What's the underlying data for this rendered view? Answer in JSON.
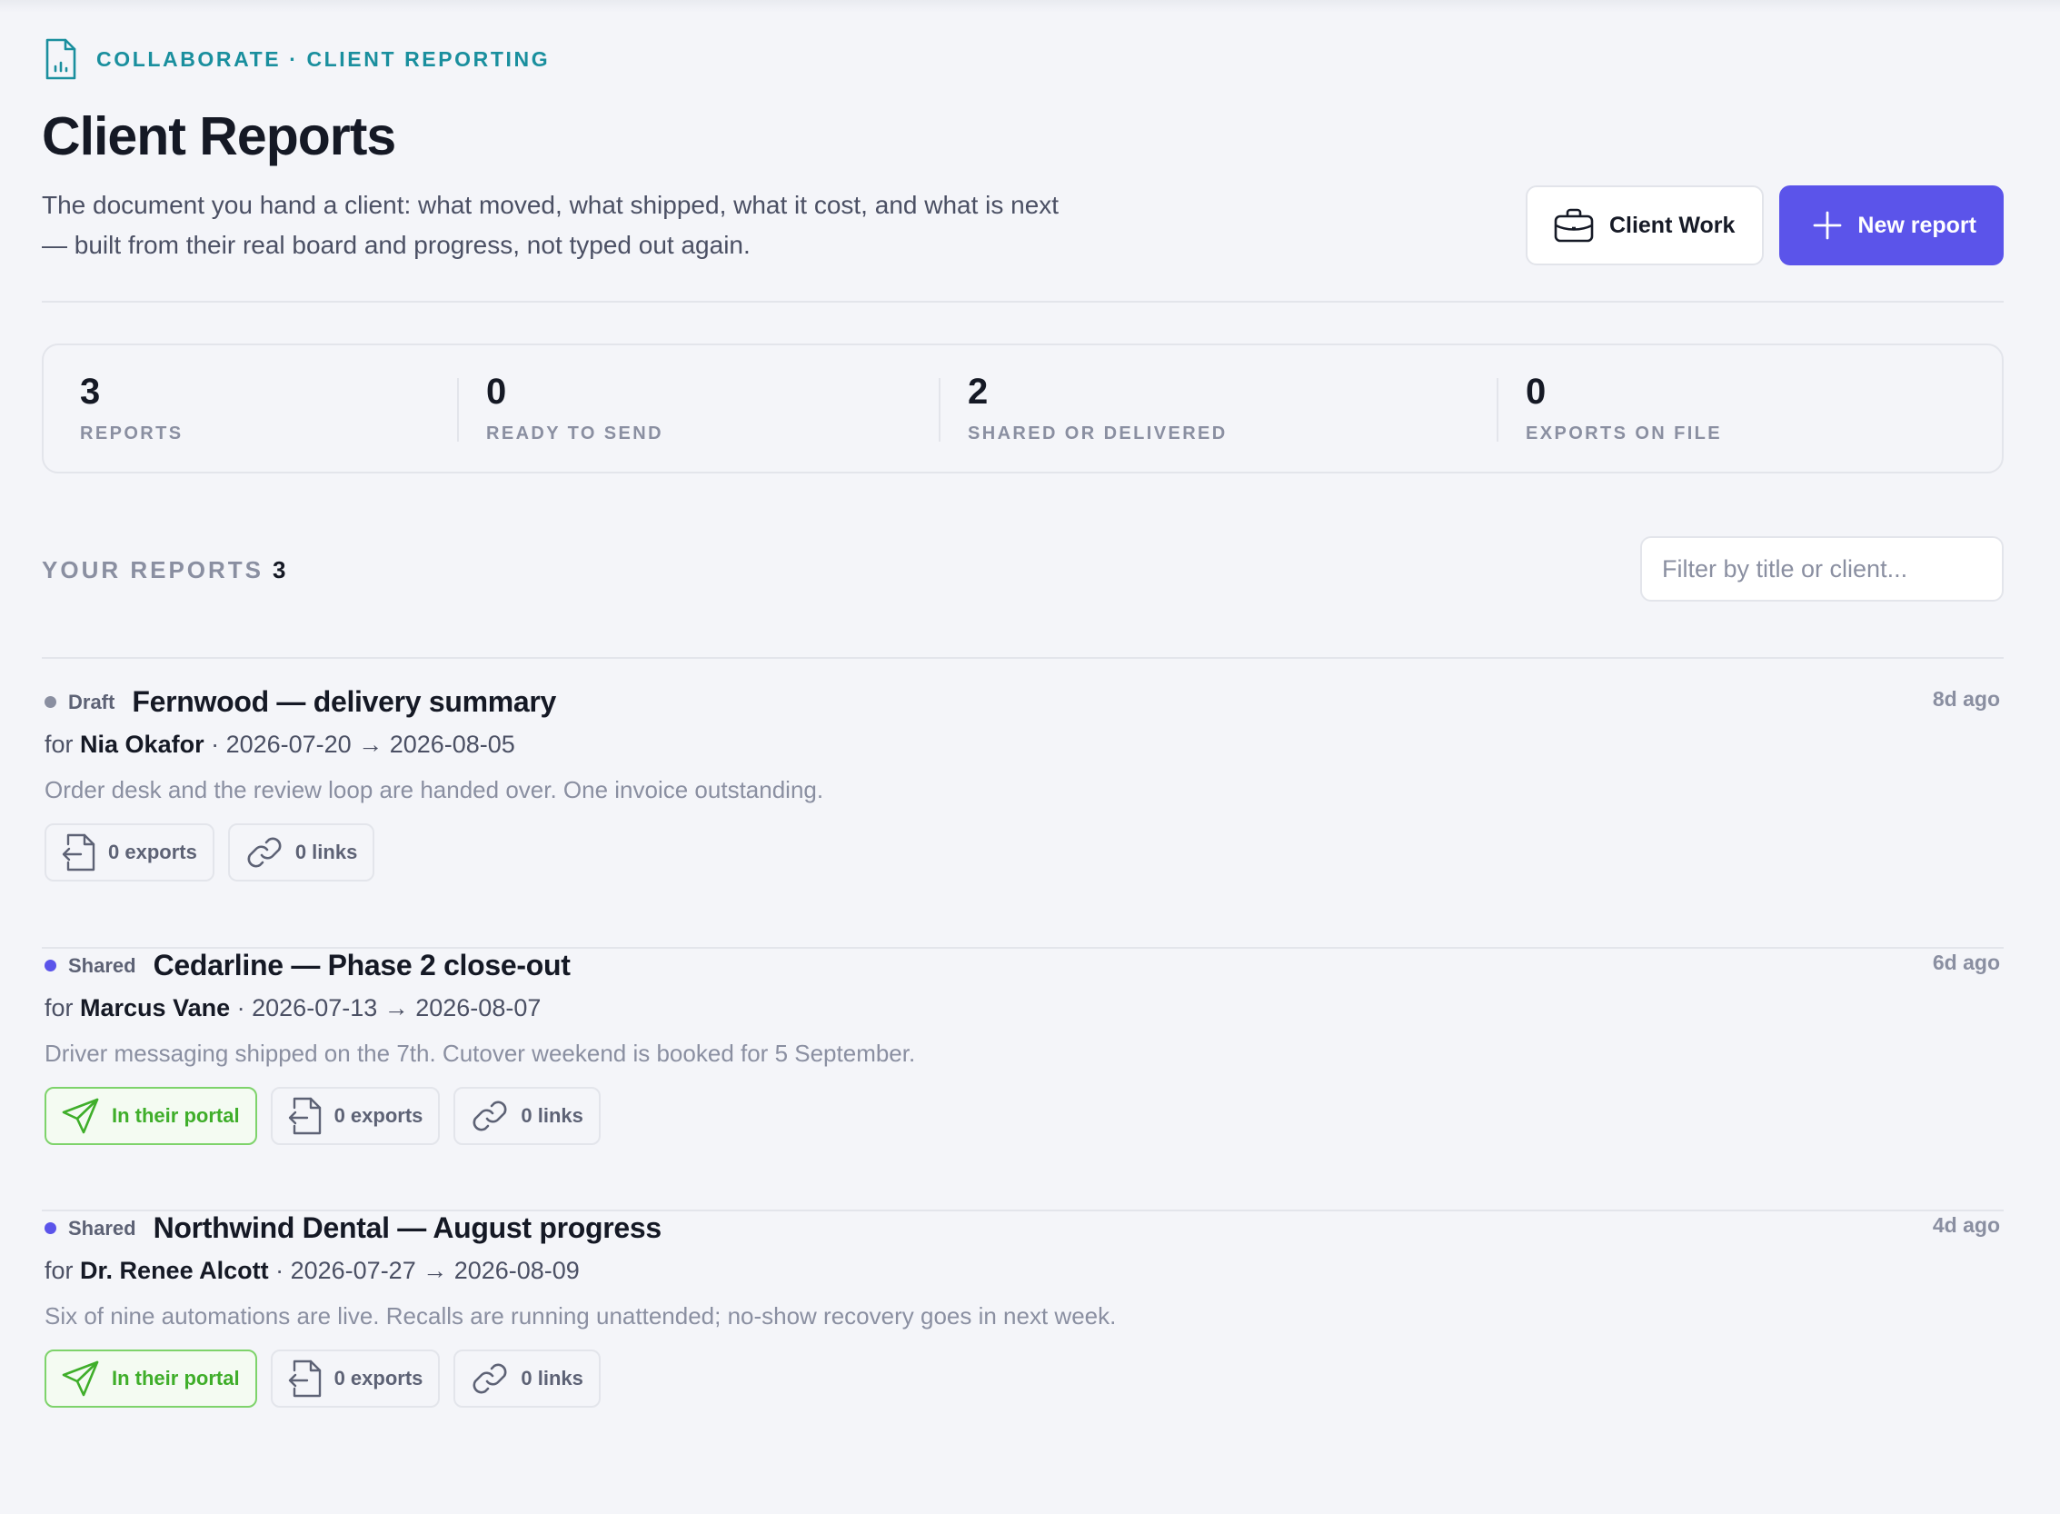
{
  "breadcrumb": "COLLABORATE · CLIENT REPORTING",
  "page": {
    "title": "Client Reports",
    "lede": "The document you hand a client: what moved, what shipped, what it cost, and what is next — built from their real board and progress, not typed out again."
  },
  "actions": {
    "client_work_label": "Client Work",
    "new_report_label": "New report"
  },
  "stats": [
    {
      "value": "3",
      "label": "REPORTS"
    },
    {
      "value": "0",
      "label": "READY TO SEND"
    },
    {
      "value": "2",
      "label": "SHARED OR DELIVERED"
    },
    {
      "value": "0",
      "label": "EXPORTS ON FILE"
    }
  ],
  "reports_section": {
    "title": "YOUR REPORTS",
    "count": "3",
    "filter_placeholder": "Filter by title or client..."
  },
  "status_colors": {
    "Draft": "#8a8fa1",
    "Shared": "#5b54ea"
  },
  "reports": [
    {
      "status": "Draft",
      "title": "Fernwood — delivery summary",
      "for_prefix": "for",
      "client": "Nia Okafor",
      "range": "· 2026-07-20 → 2026-08-05",
      "summary": "Order desk and the review loop are handed over. One invoice outstanding.",
      "ago": "8d ago",
      "portal": "",
      "exports": "0 exports",
      "links": "0 links"
    },
    {
      "status": "Shared",
      "title": "Cedarline — Phase 2 close-out",
      "for_prefix": "for",
      "client": "Marcus Vane",
      "range": "· 2026-07-13 → 2026-08-07",
      "summary": "Driver messaging shipped on the 7th. Cutover weekend is booked for 5 September.",
      "ago": "6d ago",
      "portal": "In their portal",
      "exports": "0 exports",
      "links": "0 links"
    },
    {
      "status": "Shared",
      "title": "Northwind Dental — August progress",
      "for_prefix": "for",
      "client": "Dr. Renee Alcott",
      "range": "· 2026-07-27 → 2026-08-09",
      "summary": "Six of nine automations are live. Recalls are running unattended; no-show recovery goes in next week.",
      "ago": "4d ago",
      "portal": "In their portal",
      "exports": "0 exports",
      "links": "0 links"
    }
  ]
}
